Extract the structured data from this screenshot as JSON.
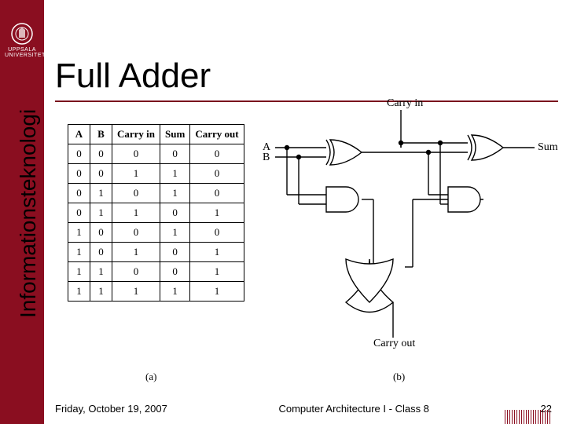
{
  "university": {
    "line1": "UPPSALA",
    "line2": "UNIVERSITET"
  },
  "sidebar_label": "Informationsteknologi",
  "title": "Full Adder",
  "truth_table": {
    "headers": [
      "A",
      "B",
      "Carry in",
      "Sum",
      "Carry out"
    ],
    "rows": [
      [
        "0",
        "0",
        "0",
        "0",
        "0"
      ],
      [
        "0",
        "0",
        "1",
        "1",
        "0"
      ],
      [
        "0",
        "1",
        "0",
        "1",
        "0"
      ],
      [
        "0",
        "1",
        "1",
        "0",
        "1"
      ],
      [
        "1",
        "0",
        "0",
        "1",
        "0"
      ],
      [
        "1",
        "0",
        "1",
        "0",
        "1"
      ],
      [
        "1",
        "1",
        "0",
        "0",
        "1"
      ],
      [
        "1",
        "1",
        "1",
        "1",
        "1"
      ]
    ]
  },
  "circuit_labels": {
    "carry_in": "Carry in",
    "A": "A",
    "B": "B",
    "sum": "Sum",
    "carry_out": "Carry out"
  },
  "captions": {
    "a": "(a)",
    "b": "(b)"
  },
  "footer": {
    "date": "Friday, October 19, 2007",
    "course": "Computer Architecture I - Class 8",
    "page": "22"
  }
}
